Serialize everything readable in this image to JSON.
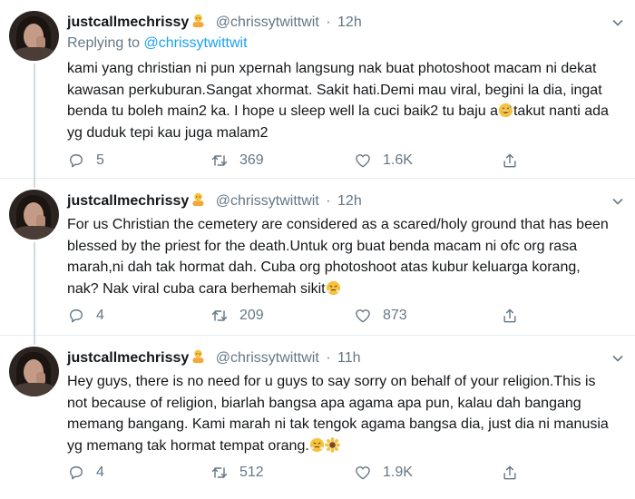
{
  "tweets": [
    {
      "display_name": "justcallmechrissy",
      "handle": "@chrissytwittwit",
      "dot": "·",
      "time": "12h",
      "replying_prefix": "Replying to",
      "replying_to": "@chrissytwittwit",
      "text_before_emoji": "kami yang christian ni pun xpernah langsung nak buat photoshoot macam ni dekat kawasan perkuburan.Sangat xhormat. Sakit hati.Demi mau viral, begini la dia, ingat benda tu boleh main2 ka. I hope u sleep well la cuci baik2 tu baju a",
      "text_after_emoji": "takut nanti ada yg duduk tepi kau juga malam2",
      "inline_emoji": "grinning-sweat-emoji",
      "replies": "5",
      "retweets": "369",
      "likes": "1.6K"
    },
    {
      "display_name": "justcallmechrissy",
      "handle": "@chrissytwittwit",
      "dot": "·",
      "time": "12h",
      "text": "For us Christian the cemetery are considered as a scared/holy ground that has been blessed by the priest for the death.Untuk org buat benda macam ni ofc org rasa marah,ni dah tak hormat dah. Cuba org photoshoot atas kubur keluarga korang, nak? Nak viral cuba cara berhemah sikit",
      "inline_emoji": "steam-face-emoji",
      "replies": "4",
      "retweets": "209",
      "likes": "873"
    },
    {
      "display_name": "justcallmechrissy",
      "handle": "@chrissytwittwit",
      "dot": "·",
      "time": "11h",
      "text": "Hey guys, there is no need for u guys to say sorry on behalf of your religion.This is not because of religion, biarlah bangsa apa agama apa pun, kalau dah bangang memang bangang. Kami marah ni tak tengok agama bangsa dia, just dia ni manusia yg memang tak hormat tempat orang.",
      "inline_emoji": "steam-face-emoji sunflower-emoji",
      "replies": "4",
      "retweets": "512",
      "likes": "1.9K"
    }
  ],
  "colors": {
    "text": "#14171a",
    "secondary": "#657786",
    "link": "#1da1f2",
    "divider": "#e6ecf0",
    "thread_line": "#cfd9de"
  }
}
